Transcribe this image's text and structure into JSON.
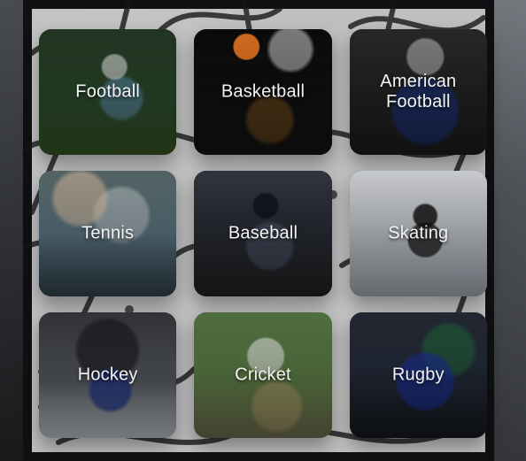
{
  "sports": [
    {
      "id": "football",
      "label": "Football"
    },
    {
      "id": "basketball",
      "label": "Basketball"
    },
    {
      "id": "american-football",
      "label": "American\nFootball"
    },
    {
      "id": "tennis",
      "label": "Tennis"
    },
    {
      "id": "baseball",
      "label": "Baseball"
    },
    {
      "id": "skating",
      "label": "Skating"
    },
    {
      "id": "hockey",
      "label": "Hockey"
    },
    {
      "id": "cricket",
      "label": "Cricket"
    },
    {
      "id": "rugby",
      "label": "Rugby"
    }
  ]
}
